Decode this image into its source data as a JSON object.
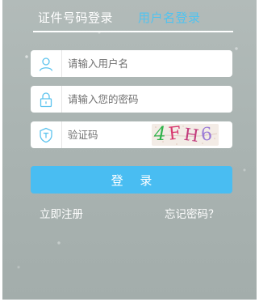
{
  "tabs": {
    "id_login": "证件号码登录",
    "username_login": "用户名登录",
    "active": "username_login"
  },
  "form": {
    "username": {
      "placeholder": "请输入用户名",
      "value": ""
    },
    "password": {
      "placeholder": "请输入您的密码",
      "value": ""
    },
    "captcha": {
      "placeholder": "验证码",
      "value": "",
      "image_text": "4FH6"
    }
  },
  "actions": {
    "login": "登 录",
    "register": "立即注册",
    "forgot_password": "忘记密码？"
  },
  "colors": {
    "accent": "#49bdf2",
    "active_tab": "#4fc3f0",
    "icon": "#5cc3ee"
  },
  "icons": {
    "username": "user-icon",
    "password": "lock-icon",
    "captcha": "shield-icon"
  }
}
